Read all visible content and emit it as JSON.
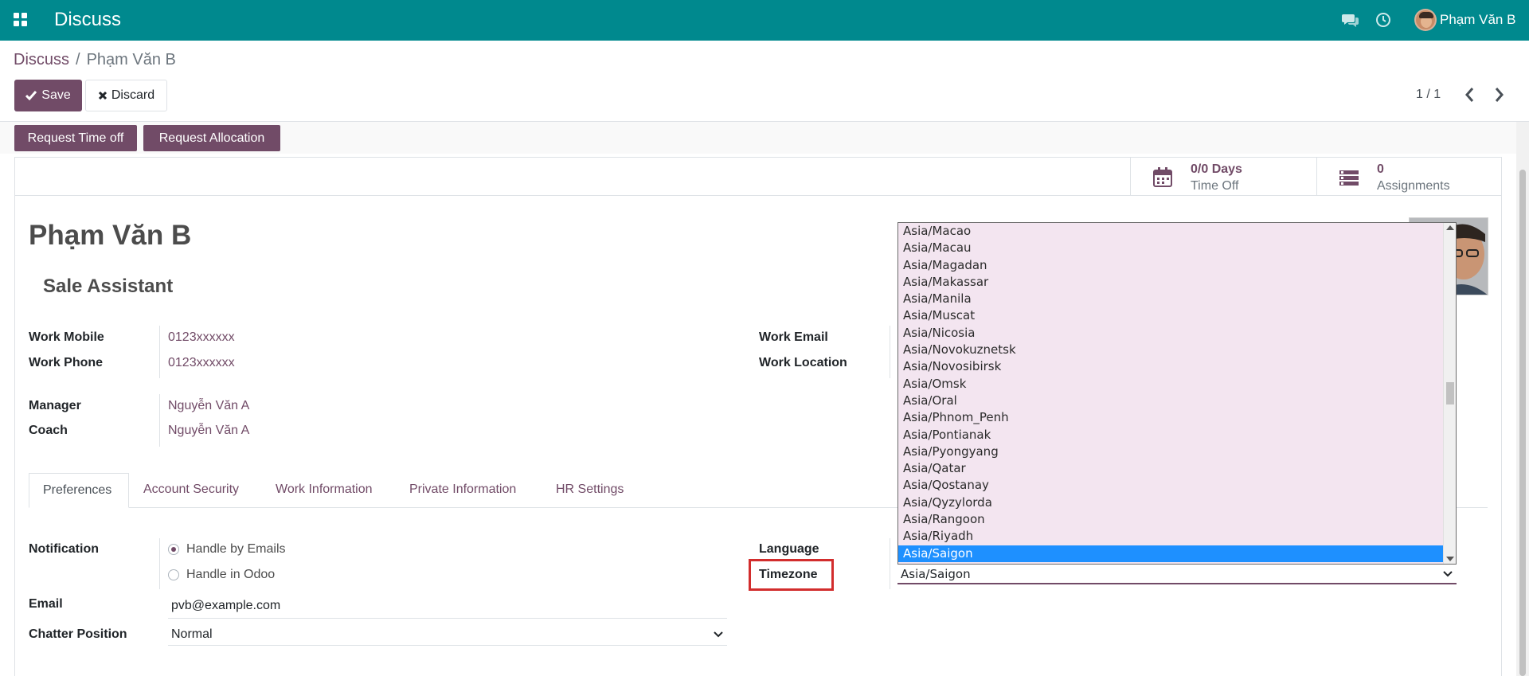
{
  "topbar": {
    "app_title": "Discuss",
    "user_name": "Phạm Văn B",
    "bar_color": "#00898e"
  },
  "breadcrumb": {
    "parent": "Discuss",
    "separator": "/",
    "current": "Phạm Văn B"
  },
  "actions": {
    "save_label": "Save",
    "discard_label": "Discard"
  },
  "pager": {
    "value": "1 / 1"
  },
  "status_buttons": {
    "request_time_off": "Request Time off",
    "request_allocation": "Request Allocation"
  },
  "stat_buttons": {
    "time_off_value": "0/0 Days",
    "time_off_label": "Time Off",
    "assignments_value": "0",
    "assignments_label": "Assignments"
  },
  "employee": {
    "name": "Phạm Văn B",
    "job_title": "Sale Assistant"
  },
  "fields": {
    "work_mobile_label": "Work Mobile",
    "work_mobile_value": "0123xxxxxx",
    "work_phone_label": "Work Phone",
    "work_phone_value": "0123xxxxxx",
    "manager_label": "Manager",
    "manager_value": "Nguyễn Văn A",
    "coach_label": "Coach",
    "coach_value": "Nguyễn Văn A",
    "work_email_label": "Work Email",
    "work_location_label": "Work Location"
  },
  "tabs": [
    {
      "label": "Preferences",
      "active": true
    },
    {
      "label": "Account Security",
      "active": false
    },
    {
      "label": "Work Information",
      "active": false
    },
    {
      "label": "Private Information",
      "active": false
    },
    {
      "label": "HR Settings",
      "active": false
    }
  ],
  "preferences": {
    "notification_label": "Notification",
    "notification_options": [
      "Handle by Emails",
      "Handle in Odoo"
    ],
    "notification_selected": "Handle by Emails",
    "email_label": "Email",
    "email_value": "pvb@example.com",
    "chatter_label": "Chatter Position",
    "chatter_value": "Normal",
    "language_label": "Language",
    "timezone_label": "Timezone",
    "timezone_value": "Asia/Saigon"
  },
  "timezone_dropdown": {
    "options": [
      "Asia/Macao",
      "Asia/Macau",
      "Asia/Magadan",
      "Asia/Makassar",
      "Asia/Manila",
      "Asia/Muscat",
      "Asia/Nicosia",
      "Asia/Novokuznetsk",
      "Asia/Novosibirsk",
      "Asia/Omsk",
      "Asia/Oral",
      "Asia/Phnom_Penh",
      "Asia/Pontianak",
      "Asia/Pyongyang",
      "Asia/Qatar",
      "Asia/Qostanay",
      "Asia/Qyzylorda",
      "Asia/Rangoon",
      "Asia/Riyadh",
      "Asia/Saigon"
    ],
    "selected": "Asia/Saigon",
    "highlight_color": "#1e90ff"
  }
}
